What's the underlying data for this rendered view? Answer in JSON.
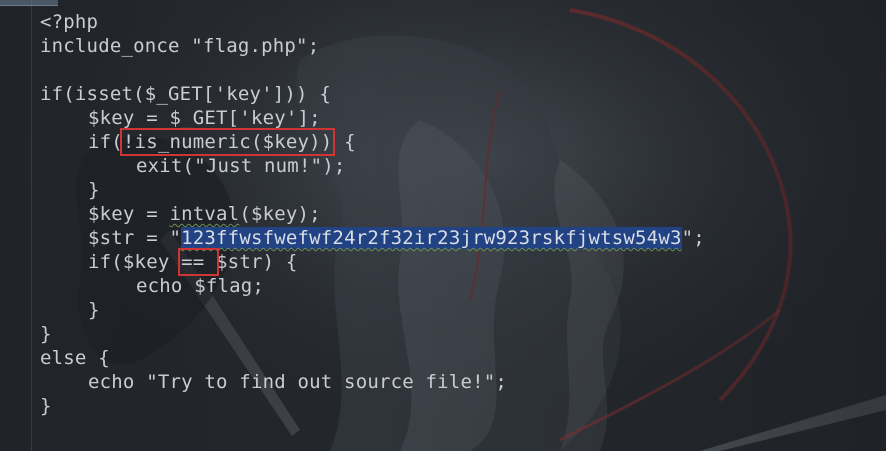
{
  "editor": {
    "language": "php",
    "lines": [
      {
        "text": "<?php"
      },
      {
        "text": "include_once \"flag.php\";"
      },
      {
        "text": ""
      },
      {
        "text": "if(isset($_GET['key'])) {"
      },
      {
        "text": "$key = $_GET['key'];"
      },
      {
        "pre": "if(",
        "boxed": "!is_numeric($key))",
        "post": " {"
      },
      {
        "text": "exit(\"Just num!\");"
      },
      {
        "text": "}"
      },
      {
        "pre": "$key = ",
        "wavy": "intval",
        "post": "($key);"
      },
      {
        "pre": "$str = \"",
        "selected": "123ffwsfwefwf24r2f32ir23jrw923rskfjwtsw54w3",
        "post": "\";"
      },
      {
        "pre": "if($key ",
        "boxed": "== ",
        "post": "$str) {"
      },
      {
        "text": "echo $flag;"
      },
      {
        "text": "}"
      },
      {
        "text": "}"
      },
      {
        "text": "else {"
      },
      {
        "text": "echo \"Try to find out source file!\";"
      },
      {
        "text": "}"
      }
    ]
  },
  "colors": {
    "background": "#23272c",
    "selection": "#214283",
    "highlight_box": "#d03535"
  }
}
